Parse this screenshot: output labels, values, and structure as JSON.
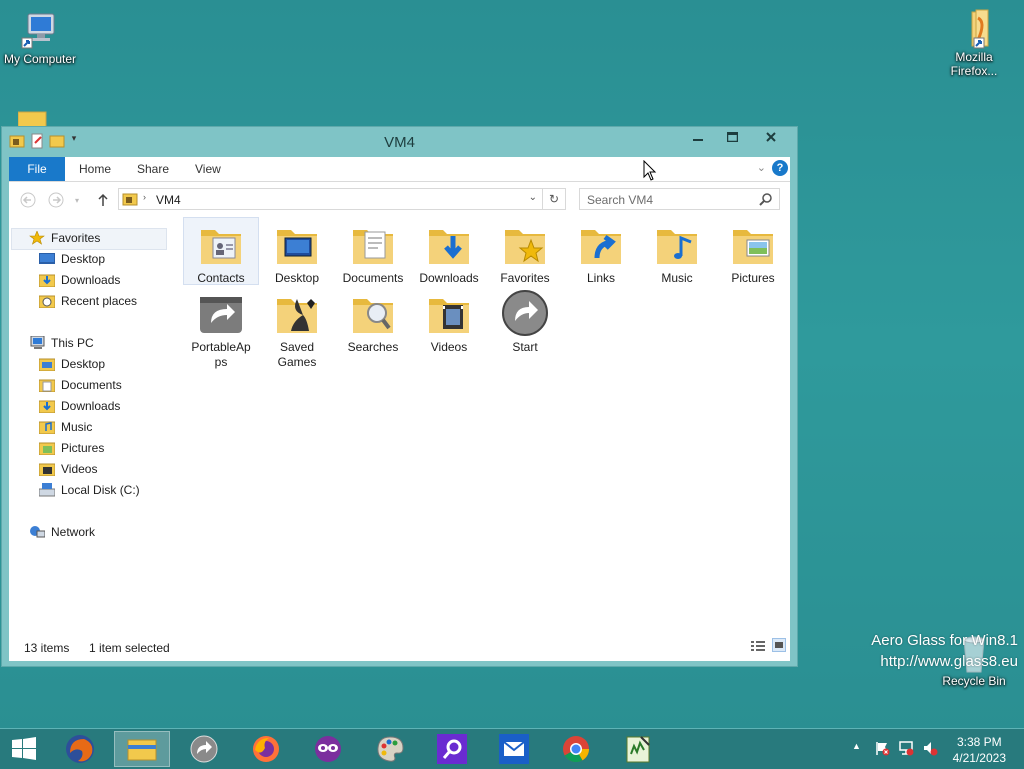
{
  "desktop": {
    "icons": [
      {
        "label": "My Computer"
      },
      {
        "label": "Mozilla Firefox..."
      },
      {
        "label": "Recycle Bin"
      }
    ],
    "watermark": {
      "line1": "Aero Glass for Win8.1",
      "line2": "http://www.glass8.eu"
    }
  },
  "window": {
    "title": "VM4",
    "ribbon_tabs": [
      "File",
      "Home",
      "Share",
      "View"
    ],
    "address": {
      "path": "VM4"
    },
    "search": {
      "placeholder": "Search VM4"
    },
    "nav": {
      "favorites_header": "Favorites",
      "favorites": [
        "Desktop",
        "Downloads",
        "Recent places"
      ],
      "thispc_header": "This PC",
      "thispc": [
        "Desktop",
        "Documents",
        "Downloads",
        "Music",
        "Pictures",
        "Videos",
        "Local Disk (C:)"
      ],
      "network": "Network"
    },
    "items": [
      {
        "label": "Contacts",
        "icon": "contacts-folder-icon",
        "selected": true
      },
      {
        "label": "Desktop",
        "icon": "desktop-folder-icon"
      },
      {
        "label": "Documents",
        "icon": "documents-folder-icon"
      },
      {
        "label": "Downloads",
        "icon": "downloads-folder-icon"
      },
      {
        "label": "Favorites",
        "icon": "favorites-folder-icon"
      },
      {
        "label": "Links",
        "icon": "links-folder-icon"
      },
      {
        "label": "Music",
        "icon": "music-folder-icon"
      },
      {
        "label": "Pictures",
        "icon": "pictures-folder-icon"
      },
      {
        "label": "PortableAp ps",
        "icon": "portableapps-icon"
      },
      {
        "label": "Saved Games",
        "icon": "saved-games-folder-icon"
      },
      {
        "label": "Searches",
        "icon": "searches-folder-icon"
      },
      {
        "label": "Videos",
        "icon": "videos-folder-icon"
      },
      {
        "label": "Start",
        "icon": "start-icon"
      }
    ],
    "status": {
      "count": "13 items",
      "selection": "1 item selected"
    }
  },
  "taskbar": {
    "apps": [
      "start-button",
      "firefox",
      "file-explorer",
      "portableapps",
      "firefox-alt",
      "mask-app",
      "paint",
      "search-app",
      "mail",
      "chrome",
      "notepad"
    ],
    "clock": {
      "time": "3:38 PM",
      "date": "4/21/2023"
    }
  },
  "colors": {
    "accent": "#1979ca",
    "folder": "#f2c94c",
    "frame": "#7fc4c6",
    "desktop": "#2f9a9c"
  }
}
